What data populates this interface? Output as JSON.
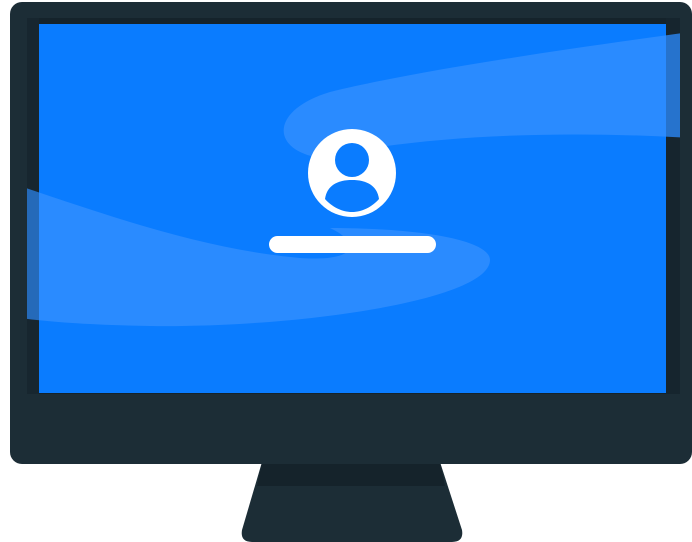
{
  "illustration": {
    "subject": "monitor-login-screen-icon",
    "colors": {
      "bezel": "#1c2d36",
      "bezel_inner": "#15232b",
      "screen": "#0a7cff",
      "screen_wave": "#2a8bff",
      "avatar": "#ffffff",
      "username_bar": "#ffffff"
    },
    "icons": {
      "avatar": "user-avatar-icon",
      "username_placeholder": "username-bar"
    }
  }
}
